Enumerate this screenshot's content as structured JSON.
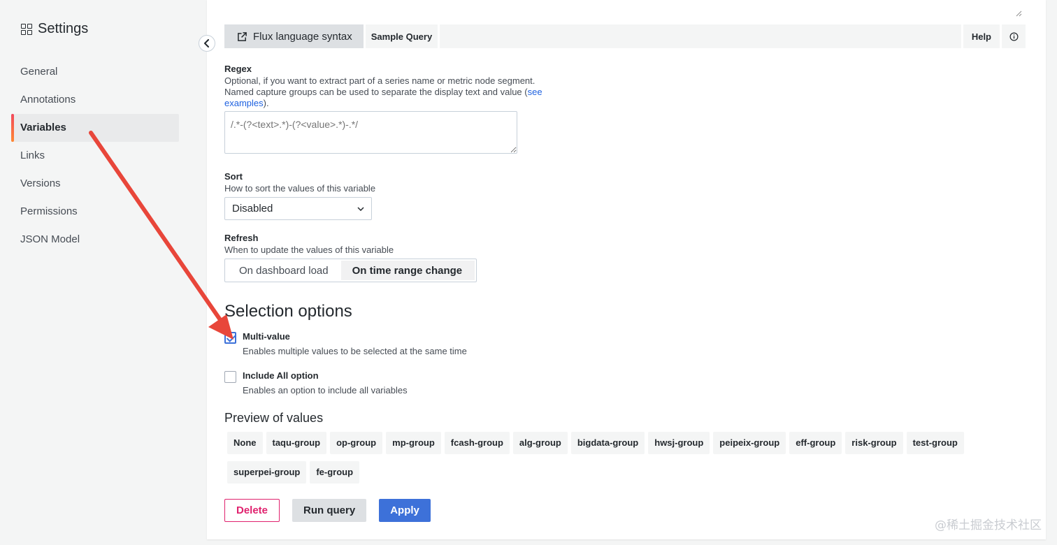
{
  "sidebar": {
    "title": "Settings",
    "items": [
      {
        "label": "General",
        "active": false
      },
      {
        "label": "Annotations",
        "active": false
      },
      {
        "label": "Variables",
        "active": true
      },
      {
        "label": "Links",
        "active": false
      },
      {
        "label": "Versions",
        "active": false
      },
      {
        "label": "Permissions",
        "active": false
      },
      {
        "label": "JSON Model",
        "active": false
      }
    ]
  },
  "toolbar": {
    "flux_label": "Flux language syntax",
    "sample_query_label": "Sample Query",
    "help_label": "Help"
  },
  "regex": {
    "label": "Regex",
    "desc_line1": "Optional, if you want to extract part of a series name or metric node segment.",
    "desc_line2_prefix": "Named capture groups can be used to separate the display text and value (",
    "desc_link_part1": "see",
    "desc_link_part2": "examples",
    "desc_suffix": ").",
    "placeholder": "/.*-(?<text>.*)-(?<value>.*)-.*/"
  },
  "sort": {
    "label": "Sort",
    "desc": "How to sort the values of this variable",
    "selected": "Disabled"
  },
  "refresh": {
    "label": "Refresh",
    "desc": "When to update the values of this variable",
    "options": [
      "On dashboard load",
      "On time range change"
    ],
    "selected_index": 1
  },
  "selection": {
    "heading": "Selection options",
    "multi_value": {
      "label": "Multi-value",
      "desc": "Enables multiple values to be selected at the same time",
      "checked": true
    },
    "include_all": {
      "label": "Include All option",
      "desc": "Enables an option to include all variables",
      "checked": false
    }
  },
  "preview": {
    "heading": "Preview of values",
    "values": [
      "None",
      "taqu-group",
      "op-group",
      "mp-group",
      "fcash-group",
      "alg-group",
      "bigdata-group",
      "hwsj-group",
      "peipeix-group",
      "eff-group",
      "risk-group",
      "test-group",
      "superpei-group",
      "fe-group"
    ]
  },
  "actions": {
    "delete_label": "Delete",
    "run_label": "Run query",
    "apply_label": "Apply"
  },
  "watermark": "@稀土掘金技术社区",
  "colors": {
    "accent": "#3d71d9",
    "danger": "#e0226e",
    "annotation_arrow": "#e8463a"
  }
}
